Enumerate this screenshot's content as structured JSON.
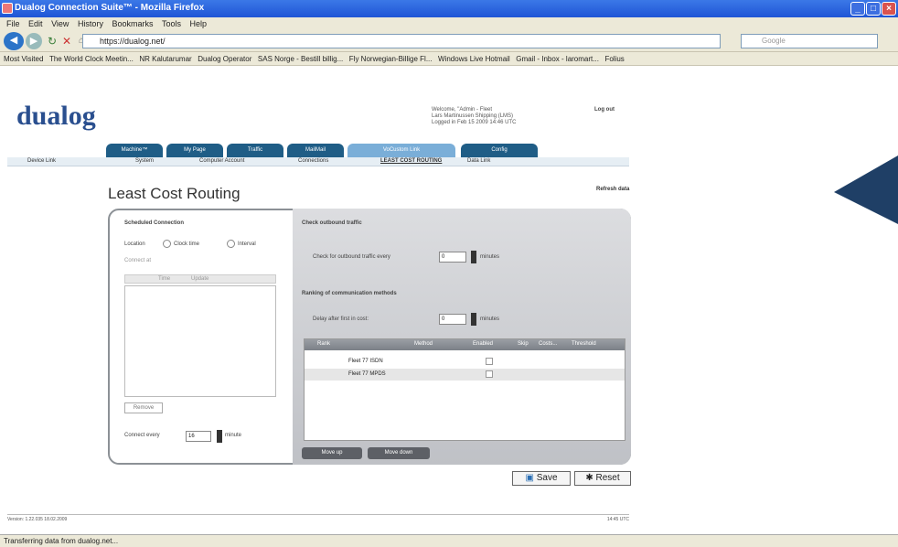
{
  "window": {
    "title": "Dualog Connection Suite™ - Mozilla Firefox"
  },
  "menu": [
    "File",
    "Edit",
    "View",
    "History",
    "Bookmarks",
    "Tools",
    "Help"
  ],
  "nav": {
    "url": "https://dualog.net/",
    "search_placeholder": "Google"
  },
  "bookmarks": [
    "Most Visited",
    "The World Clock Meetin...",
    "NR Kalutarumar",
    "Dualog Operator",
    "SAS Norge - Bestill billig...",
    "Fly Norwegian-Billige Fl...",
    "Windows Live Hotmail",
    "Gmail - Inbox - laromart...",
    "Folius"
  ],
  "app": {
    "logo": "dualog",
    "welcome_line1": "Welcome, \"Admin - Fleet",
    "welcome_line2": "Lars Martinussen Shipping (LMS)",
    "welcome_line3": "Logged in Feb 15 2009 14:46 UTC",
    "logout": "Log out",
    "tabs": [
      "Machine™",
      "My Page",
      "Traffic",
      "MailMail",
      "VoCustom Link",
      "Config"
    ],
    "subnav": [
      "Device Link",
      "System",
      "Computer Account",
      "Connections",
      "LEAST COST ROUTING",
      "Data Link"
    ],
    "page_title": "Least Cost Routing",
    "refresh": "Refresh data"
  },
  "scheduled": {
    "heading": "Scheduled Connection",
    "location_label": "Location",
    "clock_label": "Clock time",
    "interval_label": "Interval",
    "connect_at": "Connect at",
    "list_col1": "Time",
    "list_col2": "Update",
    "remove": "Remove",
    "connect_every": "Connect every",
    "connect_value": "16",
    "minute": "minute"
  },
  "outbound": {
    "heading": "Check outbound traffic",
    "check_label": "Check for outbound traffic every",
    "check_value": "0",
    "check_unit": "minutes",
    "ranking_heading": "Ranking of communication methods",
    "delay_label": "Delay after first in cost:",
    "delay_value": "0",
    "delay_unit": "minutes",
    "columns": [
      "Rank",
      "Method",
      "Enabled",
      "Skip",
      "Costs...",
      "Threshold"
    ],
    "rows": [
      {
        "method": "Fleet 77 ISDN"
      },
      {
        "method": "Fleet 77 MPDS"
      }
    ],
    "move_up": "Move up",
    "move_down": "Move down"
  },
  "actions": {
    "save": "Save",
    "reset": "Reset"
  },
  "footer": {
    "version": "Version: 1.22.035 18.02.2009",
    "time": "14:45 UTC"
  },
  "status": "Transferring data from dualog.net..."
}
